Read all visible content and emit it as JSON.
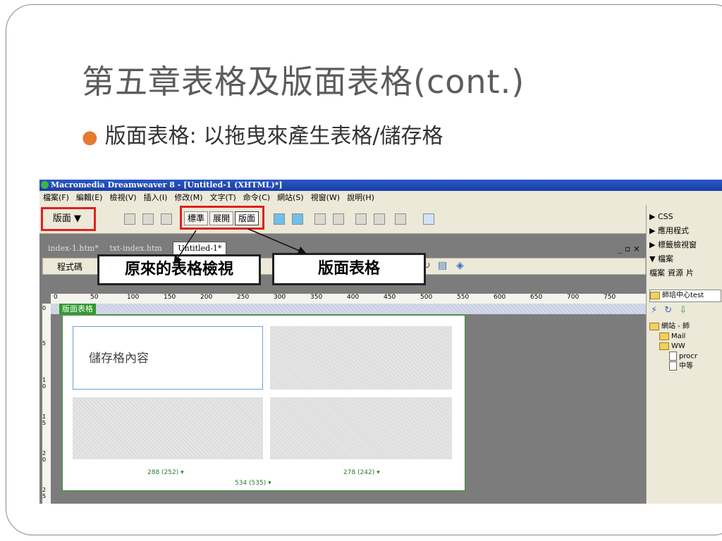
{
  "slide": {
    "title": "第五章表格及版面表格(cont.)",
    "bullet": "版面表格: 以拖曳來產生表格/儲存格"
  },
  "app": {
    "window_title": "Macromedia Dreamweaver 8 - [Untitled-1 (XHTML)*]",
    "menu": [
      "檔案(F)",
      "編輯(E)",
      "檢視(V)",
      "插入(I)",
      "修改(M)",
      "文字(T)",
      "命令(C)",
      "網站(S)",
      "視窗(W)",
      "說明(H)"
    ]
  },
  "toolbar": {
    "view_mode": "版面 ▼",
    "modes": [
      "標準",
      "展開",
      "版面"
    ],
    "active_mode": "版面"
  },
  "document": {
    "tabs": [
      "index-1.htm*",
      "txt-index.htm",
      "Untitled-1*"
    ],
    "window_controls": "_ ▫ ×",
    "code_button": "程式碼",
    "layout_table_tag": "版面表格",
    "cell_text": "儲存格內容",
    "ruler_marks": [
      "0",
      "50",
      "100",
      "150",
      "200",
      "250",
      "300",
      "350",
      "400",
      "450",
      "500",
      "550",
      "600",
      "650",
      "700",
      "750"
    ],
    "ruler_left_marks": [
      "0",
      "5",
      "1 0",
      "1 5",
      "2 0",
      "2 5"
    ],
    "col1_width": "288 (252) ▾",
    "col2_width": "278 (242) ▾",
    "table_width": "534 (535) ▾"
  },
  "callouts": {
    "left": "原來的表格檢視",
    "right": "版面表格"
  },
  "panel": {
    "css": "▶ CSS",
    "app": "▶ 應用程式",
    "tag_inspector": "▶ 標籤檢視窗",
    "files": "▼ 檔案",
    "tabs": [
      "檔案",
      "資源",
      "片"
    ],
    "site": "師培中心test",
    "tree": [
      "網站 - 師",
      "Mail",
      "WW",
      "procr",
      "中等"
    ]
  },
  "colors": {
    "accent_red": "#e02020",
    "layout_green": "#2d9a2d",
    "bullet_orange": "#e8782e"
  }
}
